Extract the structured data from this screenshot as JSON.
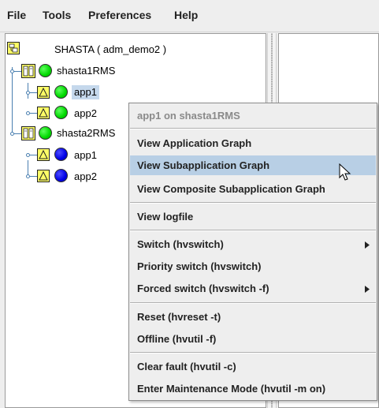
{
  "menubar": {
    "items": [
      "File",
      "Tools",
      "Preferences",
      "Help"
    ]
  },
  "tree": {
    "root": {
      "label": "SHASTA ( adm_demo2 )",
      "icon": "cluster-icon"
    },
    "nodes": [
      {
        "label": "shasta1RMS",
        "status_color": "#00d800",
        "icon": "host-book-icon"
      },
      {
        "label": "app1",
        "status_color": "#00d800",
        "icon": "warning-triangle-icon",
        "selected": true
      },
      {
        "label": "app2",
        "status_color": "#00d800",
        "icon": "warning-triangle-icon"
      },
      {
        "label": "shasta2RMS",
        "status_color": "#00d800",
        "icon": "host-book-icon"
      },
      {
        "label": "app1",
        "status_color": "#0000e6",
        "icon": "warning-triangle-icon"
      },
      {
        "label": "app2",
        "status_color": "#0000e6",
        "icon": "warning-triangle-icon"
      }
    ]
  },
  "context_menu": {
    "header": "app1 on shasta1RMS",
    "groups": [
      [
        "View Application Graph",
        "View Subapplication Graph",
        "View Composite Subapplication Graph"
      ],
      [
        "View logfile"
      ],
      [
        "Switch (hvswitch)",
        "Priority switch (hvswitch)",
        "Forced switch (hvswitch -f)"
      ],
      [
        "Reset (hvreset -t)",
        "Offline (hvutil -f)"
      ],
      [
        "Clear fault (hvutil -c)",
        "Enter Maintenance Mode (hvutil -m on)"
      ]
    ],
    "hovered": "View Subapplication Graph",
    "submenu_items": [
      "Switch (hvswitch)",
      "Forced switch (hvswitch -f)"
    ]
  },
  "colors": {
    "selection": "#c5d8ec",
    "menu_hover": "#b8cfe5",
    "status_green": "#00d800",
    "status_blue": "#0000e6",
    "tree_line": "#4a7fb0"
  }
}
